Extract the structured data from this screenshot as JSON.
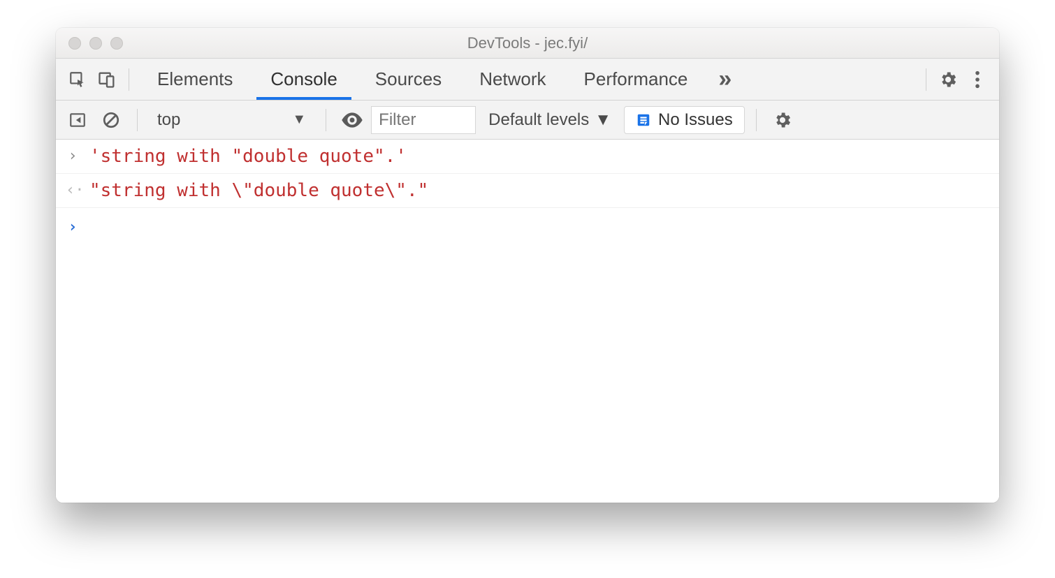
{
  "window": {
    "title": "DevTools - jec.fyi/"
  },
  "tabs": {
    "elements": "Elements",
    "console": "Console",
    "sources": "Sources",
    "network": "Network",
    "performance": "Performance"
  },
  "toolbar": {
    "context": "top",
    "filter_placeholder": "Filter",
    "levels": "Default levels",
    "issues": "No Issues"
  },
  "console": {
    "input_line": "'string with \"double quote\".'",
    "output_line": "\"string with \\\"double quote\\\".\""
  }
}
